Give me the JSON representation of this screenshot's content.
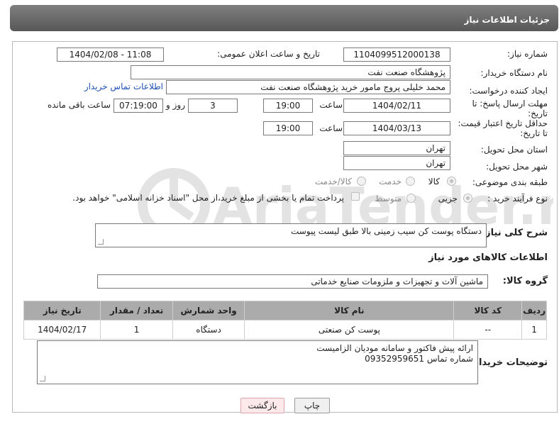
{
  "header": {
    "title": "جزئیات اطلاعات نیاز"
  },
  "fields": {
    "need_number_label": "شماره نیاز:",
    "need_number": "1104099512000138",
    "announce_label": "تاریخ و ساعت اعلان عمومی:",
    "announce_value": "1404/02/08 - 11:08",
    "buyer_org_label": "نام دستگاه خریدار:",
    "buyer_org": "پژوهشگاه صنعت نفت",
    "creator_label": "ایجاد کننده درخواست:",
    "creator": "محمد خلیلی پروج مامور خرید پژوهشگاه صنعت نفت",
    "buyer_contact_link": "اطلاعات تماس خریدار",
    "deadline_label_1": "مهلت ارسال پاسخ: تا",
    "deadline_label_2": "تاریخ:",
    "deadline_date": "1404/02/11",
    "hour_label": "ساعت",
    "deadline_time": "19:00",
    "days": "3",
    "days_label": "روز و",
    "remaining_time": "07:19:00",
    "remaining_label": "ساعت باقی مانده",
    "price_valid_label_1": "حداقل تاریخ اعتبار قیمت:",
    "price_valid_label_2": "تا تاریخ:",
    "price_valid_date": "1404/03/13",
    "price_valid_time": "19:00",
    "province_label": "استان محل تحویل:",
    "province": "تهران",
    "city_label": "شهر محل تحویل:",
    "city": "تهران",
    "category_label": "طبقه بندی موضوعی:",
    "category_options": [
      "کالا",
      "خدمت",
      "کالا/خدمت"
    ],
    "category_selected": "کالا",
    "process_label": "نوع فرآیند خرید :",
    "process_options": [
      "جزیی",
      "متوسط"
    ],
    "process_selected": "جزیی",
    "payment_note": "پرداخت تمام یا بخشی از مبلغ خرید،از محل \"اسناد خزانه اسلامی\" خواهد بود."
  },
  "summary": {
    "label": "شرح کلی نیاز:",
    "value": "دستگاه پوست کن سیب زمینی بالا طبق لیست پیوست"
  },
  "goods_info": {
    "section_title": "اطلاعات کالاهای مورد نیاز",
    "group_label": "گروه کالا:",
    "group_value": "ماشین آلات و تجهیزات و ملزومات صنایع خدماتی"
  },
  "table": {
    "headers": [
      "ردیف",
      "کد کالا",
      "نام کالا",
      "واحد شمارش",
      "تعداد / مقدار",
      "تاریخ نیاز"
    ],
    "rows": [
      [
        "1",
        "--",
        "پوست کن صنعتی",
        "دستگاه",
        "1",
        "1404/02/17"
      ]
    ]
  },
  "buyer_notes": {
    "label": "توضیحات خریدار:",
    "line1": "ارائه پیش فاکتور و سامانه مودیان الزامیست",
    "line2": "شماره تماس 09352959651"
  },
  "buttons": {
    "print": "چاپ",
    "back": "بازگشت"
  },
  "watermark": {
    "text": "AriaTender.neT"
  }
}
